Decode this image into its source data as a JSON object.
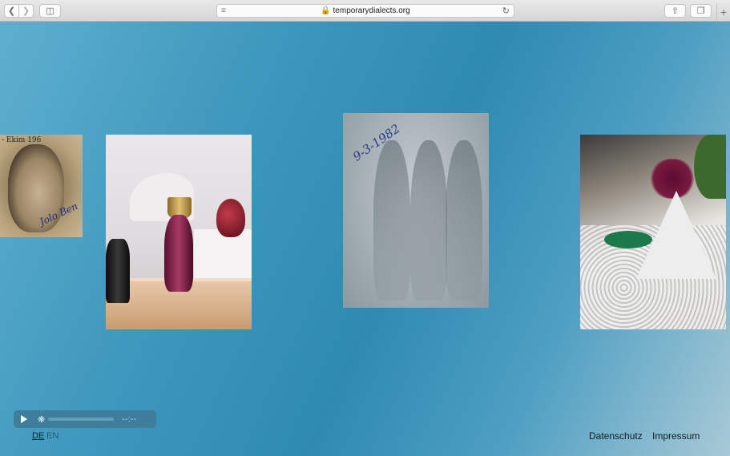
{
  "browser": {
    "url": "temporarydialects.org",
    "icons": {
      "back": "chevron-left-icon",
      "forward": "chevron-right-icon",
      "sidebar": "sidebar-icon",
      "reader": "reader-icon",
      "lock": "lock-icon",
      "reload": "reload-icon",
      "share": "share-icon",
      "tabs": "tabs-icon",
      "new_tab": "plus-icon"
    }
  },
  "photos": {
    "portrait": {
      "caption_top": "- Ekim 196",
      "caption_signature": "Jolo Ben"
    },
    "faded": {
      "date_text": "9-3-1982"
    }
  },
  "player": {
    "time": "--:--"
  },
  "languages": [
    "DE",
    "EN"
  ],
  "footer": {
    "datenschutz": "Datenschutz",
    "impressum": "Impressum"
  }
}
